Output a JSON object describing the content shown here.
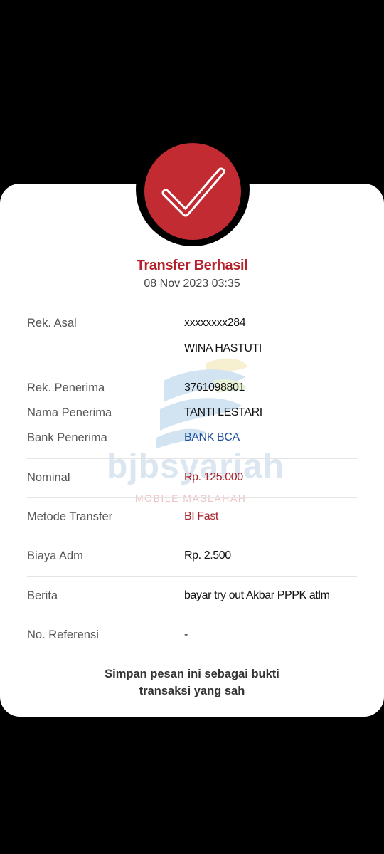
{
  "status": {
    "title": "Transfer Berhasil",
    "date": "08 Nov 2023 03:35",
    "icon": "check-icon",
    "accent": "#c32b33"
  },
  "details": {
    "rek_asal": {
      "label": "Rek. Asal",
      "account": "xxxxxxxx284",
      "name": "WINA HASTUTI"
    },
    "rek_penerima": {
      "label": "Rek. Penerima",
      "value": "3761098801"
    },
    "nama_penerima": {
      "label": "Nama Penerima",
      "value": "TANTI LESTARI"
    },
    "bank_penerima": {
      "label": "Bank Penerima",
      "value": "BANK BCA"
    },
    "nominal": {
      "label": "Nominal",
      "value": "Rp. 125.000"
    },
    "metode": {
      "label": "Metode Transfer",
      "value": "BI Fast"
    },
    "biaya": {
      "label": "Biaya Adm",
      "value": "Rp. 2.500"
    },
    "berita": {
      "label": "Berita",
      "value": "bayar try out Akbar PPPK atlm"
    },
    "referensi": {
      "label": "No. Referensi",
      "value": "-"
    }
  },
  "watermark": {
    "brand": "bjbsyariah",
    "tagline": "MOBILE MASLAHAH"
  },
  "footer": {
    "line1": "Simpan pesan ini sebagai bukti",
    "line2": "transaksi yang sah"
  }
}
